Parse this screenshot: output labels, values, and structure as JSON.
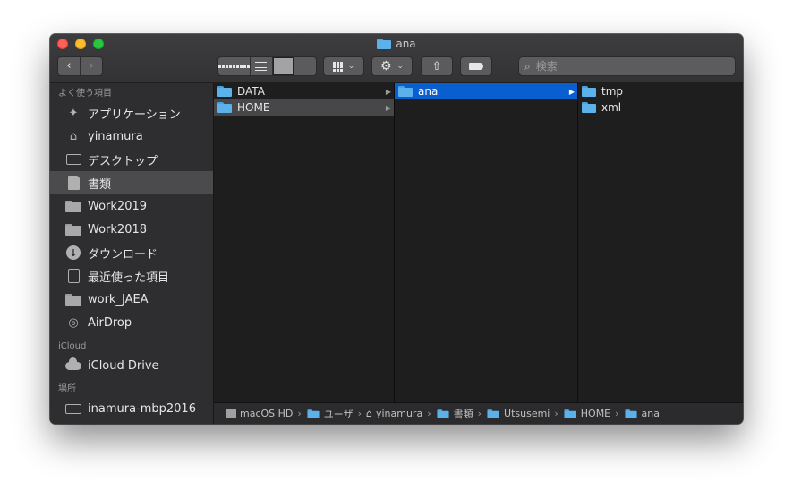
{
  "window": {
    "title": "ana"
  },
  "toolbar": {
    "back_glyph": "‹",
    "forward_glyph": "›",
    "search_placeholder": "検索"
  },
  "sidebar": {
    "sections": [
      {
        "header": "よく使う項目",
        "items": [
          {
            "label": "アプリケーション",
            "icon": "applications-icon"
          },
          {
            "label": "yinamura",
            "icon": "home-icon"
          },
          {
            "label": "デスクトップ",
            "icon": "desktop-icon"
          },
          {
            "label": "書類",
            "icon": "documents-icon",
            "selected": true
          },
          {
            "label": "Work2019",
            "icon": "folder-icon"
          },
          {
            "label": "Work2018",
            "icon": "folder-icon"
          },
          {
            "label": "ダウンロード",
            "icon": "downloads-icon"
          },
          {
            "label": "最近使った項目",
            "icon": "recents-icon"
          },
          {
            "label": "work_JAEA",
            "icon": "folder-icon"
          },
          {
            "label": "AirDrop",
            "icon": "airdrop-icon"
          }
        ]
      },
      {
        "header": "iCloud",
        "items": [
          {
            "label": "iCloud Drive",
            "icon": "cloud-icon"
          }
        ]
      },
      {
        "header": "場所",
        "items": [
          {
            "label": "inamura-mbp2016",
            "icon": "laptop-icon"
          }
        ]
      }
    ]
  },
  "columns": [
    {
      "items": [
        {
          "name": "DATA",
          "has_children": true,
          "state": "normal"
        },
        {
          "name": "HOME",
          "has_children": true,
          "state": "selected-inactive"
        }
      ]
    },
    {
      "items": [
        {
          "name": "ana",
          "has_children": true,
          "state": "selected-active"
        }
      ]
    },
    {
      "items": [
        {
          "name": "tmp",
          "has_children": false,
          "state": "normal"
        },
        {
          "name": "xml",
          "has_children": false,
          "state": "normal"
        }
      ]
    }
  ],
  "pathbar": {
    "crumbs": [
      "macOS HD",
      "ユーザ",
      "yinamura",
      "書類",
      "Utsusemi",
      "HOME",
      "ana"
    ],
    "separator": "›"
  },
  "colors": {
    "selection_active": "#0a5fd0",
    "folder_blue": "#5bb2ea",
    "window_bg": "#1e1e1f",
    "sidebar_bg": "#2e2e30"
  }
}
